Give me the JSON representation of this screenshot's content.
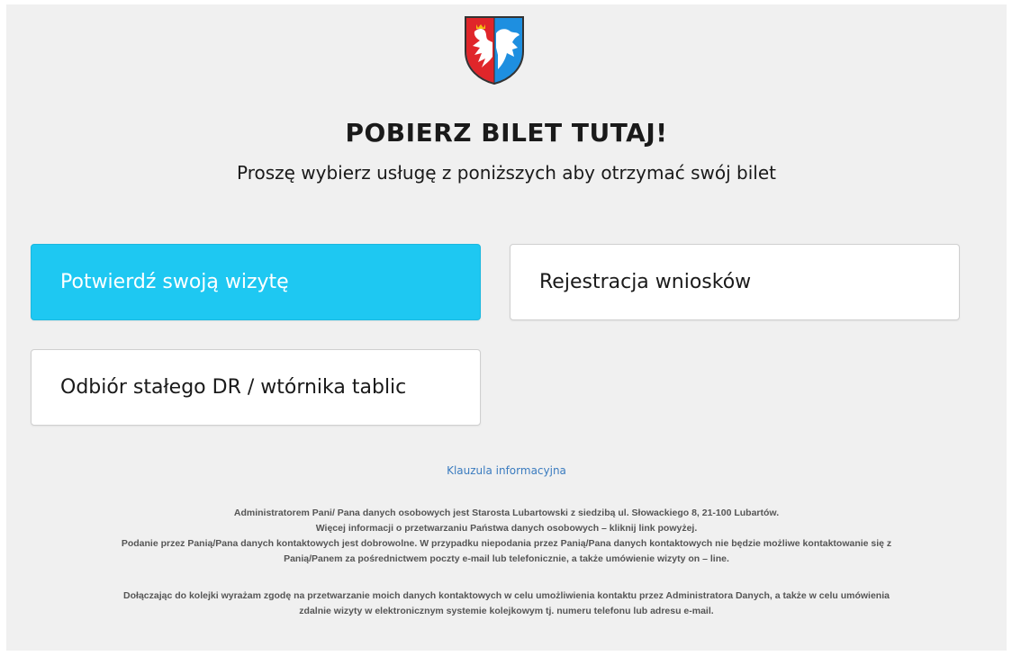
{
  "header": {
    "title": "POBIERZ BILET TUTAJ!",
    "subtitle": "Proszę wybierz usługę z poniższych aby otrzymać swój bilet"
  },
  "services": [
    {
      "label": "Potwierdź swoją wizytę",
      "active": true
    },
    {
      "label": "Rejestracja wniosków",
      "active": false
    },
    {
      "label": "Odbiór stałego DR / wtórnika tablic",
      "active": false
    }
  ],
  "footer": {
    "link_text": "Klauzula informacyjna",
    "info_lines_1": [
      "Administratorem Pani/ Pana danych osobowych jest Starosta Lubartowski z siedzibą ul. Słowackiego 8, 21-100 Lubartów.",
      "Więcej informacji o przetwarzaniu Państwa danych osobowych – kliknij link powyżej.",
      "Podanie przez Panią/Pana danych kontaktowych jest dobrowolne. W przypadku niepodania przez Panią/Pana danych kontaktowych nie będzie możliwe kontaktowanie się z",
      "Panią/Panem za pośrednictwem poczty e-mail lub telefonicznie, a także umówienie wizyty on – line."
    ],
    "info_lines_2": [
      "Dołączając do kolejki wyrażam zgodę na przetwarzanie moich danych kontaktowych w celu umożliwienia kontaktu przez Administratora Danych, a także w celu umówienia",
      "zdalnie wizyty w elektronicznym systemie kolejkowym tj. numeru telefonu lub adresu e-mail."
    ]
  },
  "colors": {
    "active_button": "#1ec8f2",
    "background": "#f0f0f0",
    "link": "#3a7bbf",
    "shield_red": "#e0262a",
    "shield_blue": "#1e8fe0"
  },
  "icons": {
    "logo": "coat-of-arms-icon"
  }
}
